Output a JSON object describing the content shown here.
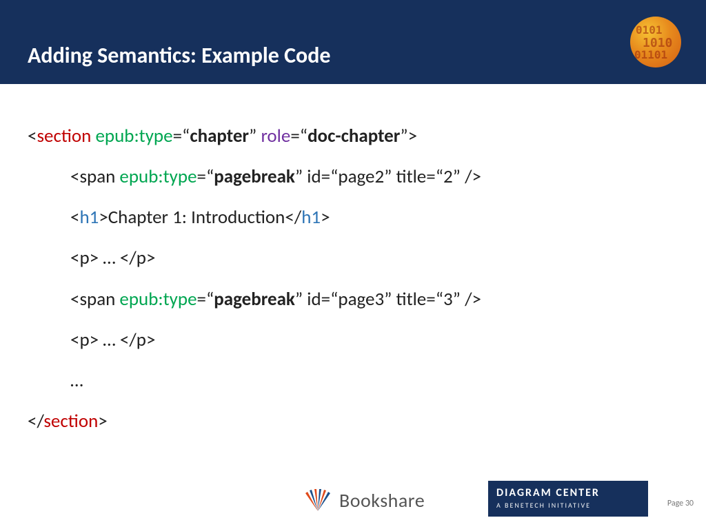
{
  "header": {
    "title": "Adding Semantics: Example Code"
  },
  "code": {
    "line1": {
      "lt": "<",
      "tag": "section",
      "space1": " ",
      "attr1": "epub:type",
      "eq1": "=“",
      "val1": "chapter",
      "close1": "” ",
      "attr2": "role",
      "eq2": "=“",
      "val2": "doc-chapter",
      "close2": "”>"
    },
    "line2": {
      "text1": "<span ",
      "attr": "epub:type",
      "eq": "=“",
      "val": "pagebreak",
      "rest": "” id=“page2” title=“2” />"
    },
    "line3": {
      "lt": "<",
      "tag": "h1",
      "gt": ">",
      "body": "Chapter 1: Introduction",
      "lt2": "</",
      "tag2": "h1",
      "gt2": ">"
    },
    "line4": {
      "text": "<p> … </p>"
    },
    "line5": {
      "text1": "<span ",
      "attr": "epub:type",
      "eq": "=“",
      "val": "pagebreak",
      "rest": "” id=“page3” title=“3” />"
    },
    "line6": {
      "text": "<p> … </p>"
    },
    "line7": {
      "text": "…"
    },
    "line8": {
      "lt": "</",
      "tag": "section",
      "gt": ">"
    }
  },
  "footer": {
    "bookshare": "Bookshare",
    "diagram_line1": "DIAGRAM CENTER",
    "diagram_line2": "A BENETECH INITIATIVE",
    "page": "Page 30"
  }
}
